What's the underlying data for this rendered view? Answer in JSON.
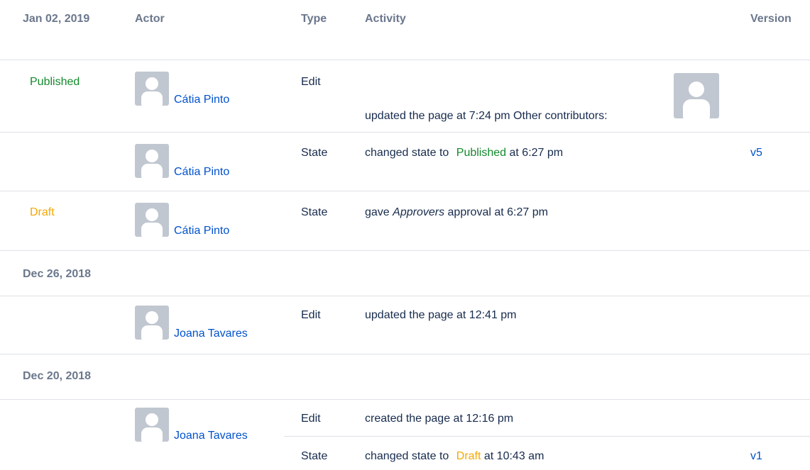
{
  "header": {
    "date": "Jan 02, 2019",
    "actor": "Actor",
    "type": "Type",
    "activity": "Activity",
    "version": "Version"
  },
  "rows": [
    {
      "state": "Published",
      "actor": "Cátia Pinto",
      "type": "Edit",
      "activity": "updated the page at 7:24 pm Other contributors:",
      "version": ""
    },
    {
      "state": "",
      "actor": "Cátia Pinto",
      "type": "State",
      "activity_prefix": "changed state to",
      "activity_state": "Published",
      "activity_suffix": "at 6:27 pm",
      "version": "v5"
    },
    {
      "state": "Draft",
      "actor": "Cátia Pinto",
      "type": "State",
      "activity_prefix": "gave",
      "activity_em": "Approvers",
      "activity_suffix": "approval at 6:27 pm",
      "version": ""
    }
  ],
  "sections": [
    {
      "date": "Dec 26, 2018",
      "actor": "Joana Tavares",
      "type": "Edit",
      "activity": "updated the page at 12:41 pm"
    },
    {
      "date": "Dec 20, 2018",
      "actor": "Joana Tavares",
      "items": [
        {
          "type": "Edit",
          "activity": "created the page at 12:16 pm"
        },
        {
          "type": "State",
          "activity_prefix": "changed state to",
          "activity_state": "Draft",
          "activity_suffix": "at 10:43 am",
          "version": "v1"
        }
      ]
    }
  ],
  "icons": {
    "avatar": "default-avatar-icon"
  },
  "colors": {
    "published": "#14892c",
    "draft": "#f6a800",
    "link": "#0052cc",
    "muted": "#6b778c"
  }
}
